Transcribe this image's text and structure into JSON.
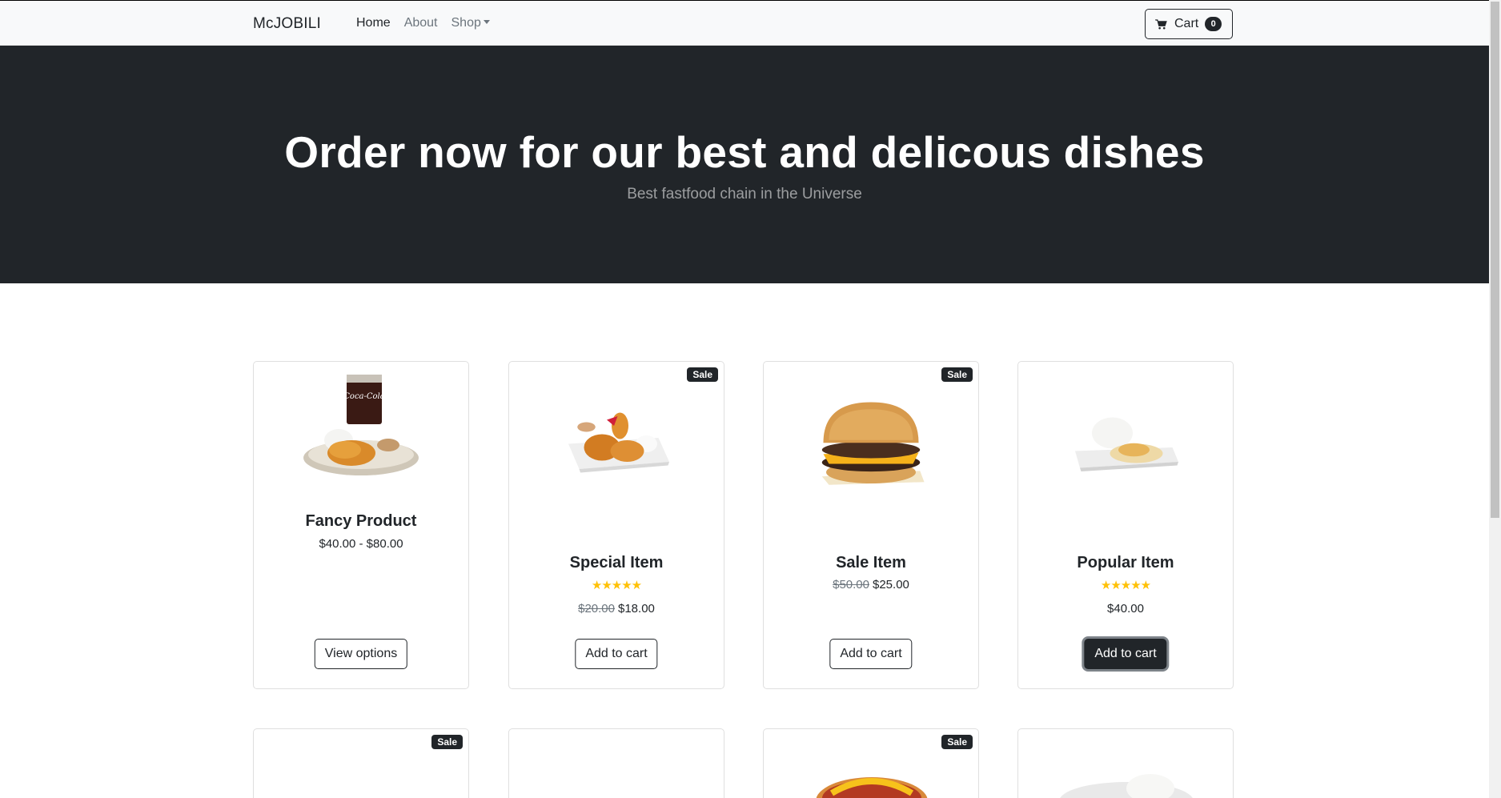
{
  "navbar": {
    "brand": "McJOBILI",
    "links": [
      {
        "label": "Home"
      },
      {
        "label": "About"
      },
      {
        "label": "Shop"
      }
    ],
    "cart_label": "Cart",
    "cart_count": "0"
  },
  "hero": {
    "title": "Order now for our best and delicous dishes",
    "subtitle": "Best fastfood chain in the Universe"
  },
  "products": [
    {
      "name": "Fancy Product",
      "price": "$40.00 - $80.00",
      "button": "View options"
    },
    {
      "name": "Special Item",
      "badge": "Sale",
      "rating": 5,
      "old_price": "$20.00",
      "price": "$18.00",
      "button": "Add to cart"
    },
    {
      "name": "Sale Item",
      "badge": "Sale",
      "old_price": "$50.00",
      "price": "$25.00",
      "button": "Add to cart"
    },
    {
      "name": "Popular Item",
      "rating": 5,
      "price": "$40.00",
      "button": "Add to cart"
    }
  ],
  "second_row_badges": [
    "Sale",
    "Sale"
  ],
  "colors": {
    "dark": "#212529",
    "star": "#ffc107",
    "navbar_bg": "#f8f9fa"
  }
}
